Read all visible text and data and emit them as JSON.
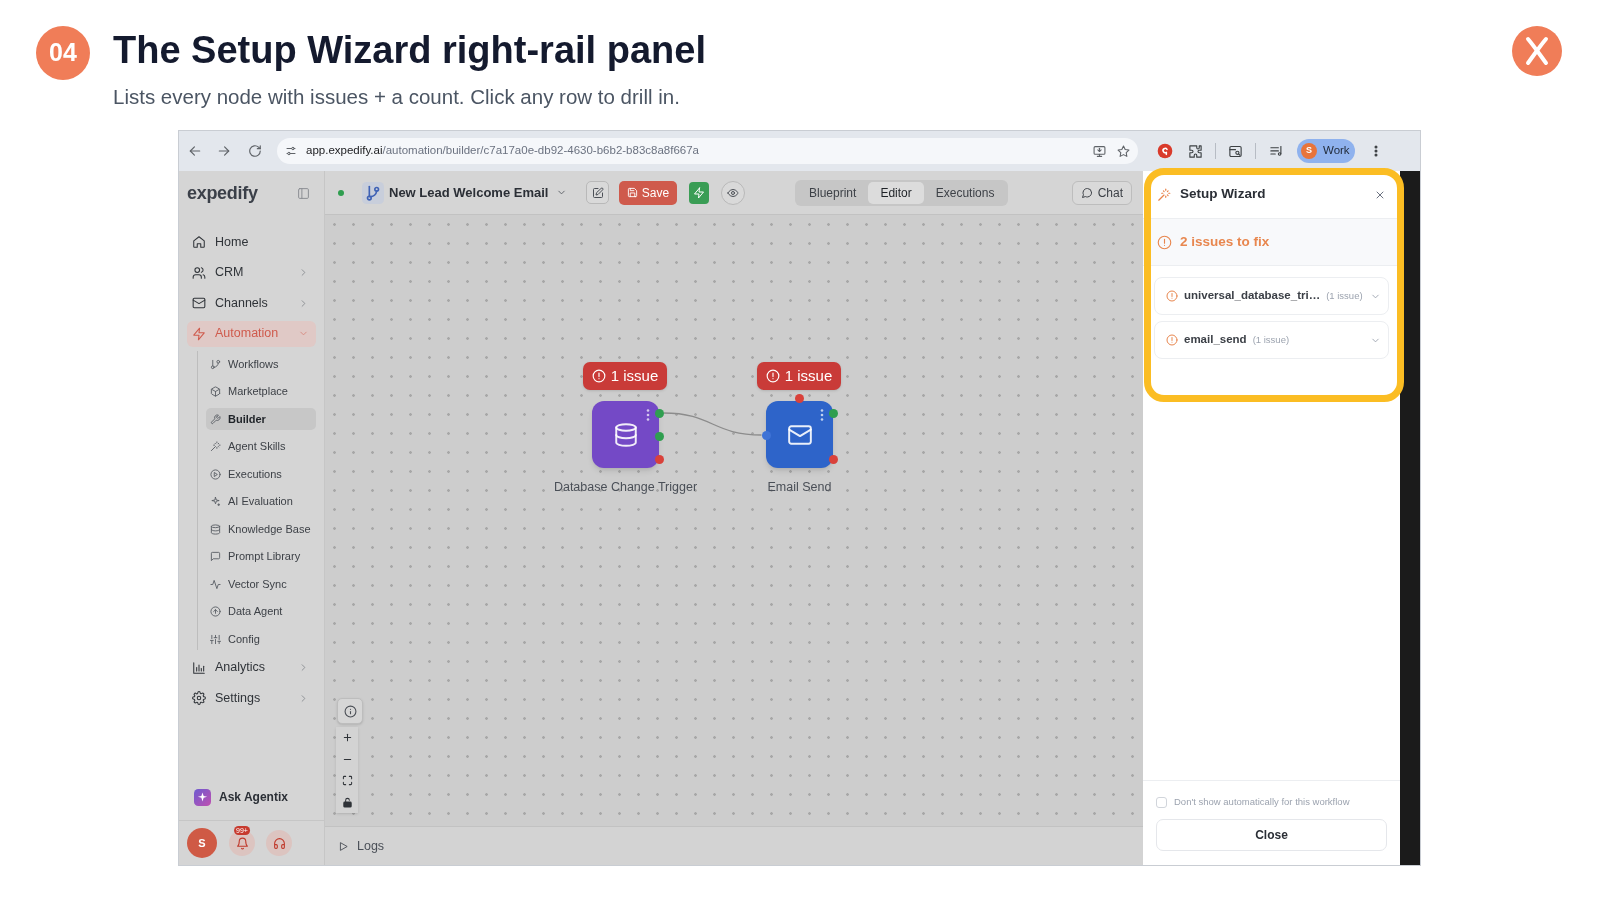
{
  "slide": {
    "number": "04",
    "title": "The Setup Wizard right-rail panel",
    "subtitle": "Lists every node with issues + a count. Click any row to drill in."
  },
  "browser": {
    "url_host": "app.expedify.ai",
    "url_path": "/automation/builder/c7a17a0e-db92-4630-b6b2-b83c8a8f667a",
    "profile_initial": "S",
    "profile_label": "Work"
  },
  "sidebar": {
    "logo": "expedify",
    "items": [
      {
        "kind": "link",
        "label": "Home",
        "selected": false
      },
      {
        "kind": "group",
        "label": "CRM",
        "selected": false,
        "expanded": false
      },
      {
        "kind": "group",
        "label": "Channels",
        "selected": false,
        "expanded": false
      },
      {
        "kind": "group",
        "label": "Automation",
        "selected": true,
        "expanded": true,
        "children": [
          {
            "label": "Workflows",
            "selected": false
          },
          {
            "label": "Marketplace",
            "selected": false
          },
          {
            "label": "Builder",
            "selected": true
          },
          {
            "label": "Agent Skills",
            "selected": false
          },
          {
            "label": "Executions",
            "selected": false
          },
          {
            "label": "AI Evaluation",
            "selected": false
          },
          {
            "label": "Knowledge Base",
            "selected": false
          },
          {
            "label": "Prompt Library",
            "selected": false
          },
          {
            "label": "Vector Sync",
            "selected": false
          },
          {
            "label": "Data Agent",
            "selected": false
          },
          {
            "label": "Config",
            "selected": false
          }
        ]
      },
      {
        "kind": "group",
        "label": "Analytics",
        "selected": false,
        "expanded": false
      },
      {
        "kind": "group",
        "label": "Settings",
        "selected": false,
        "expanded": false
      }
    ],
    "assistant": "Ask Agentix",
    "user_initial": "S",
    "notification_count": "99+"
  },
  "toolbar": {
    "workflow_active": true,
    "workflow_name": "New Lead Welcome Email",
    "save_label": "Save",
    "tabs": [
      {
        "label": "Blueprint",
        "selected": false
      },
      {
        "label": "Editor",
        "selected": true
      },
      {
        "label": "Executions",
        "selected": false
      }
    ],
    "chat_label": "Chat"
  },
  "canvas": {
    "nodes": [
      {
        "label": "Database Change Trigger",
        "badge": "1 issue",
        "color": "#7449c6"
      },
      {
        "label": "Email Send",
        "badge": "1 issue",
        "color": "#2e64c9"
      }
    ]
  },
  "logs": {
    "label": "Logs"
  },
  "setup_wizard": {
    "title": "Setup Wizard",
    "summary": "2 issues to fix",
    "items": [
      {
        "name": "universal_database_tri…",
        "count": "(1 issue)",
        "expanded": false
      },
      {
        "name": "email_send",
        "count": "(1 issue)",
        "expanded": false
      }
    ],
    "dont_show": {
      "label": "Don't show automatically for this workflow",
      "checked": false
    },
    "close_label": "Close"
  }
}
